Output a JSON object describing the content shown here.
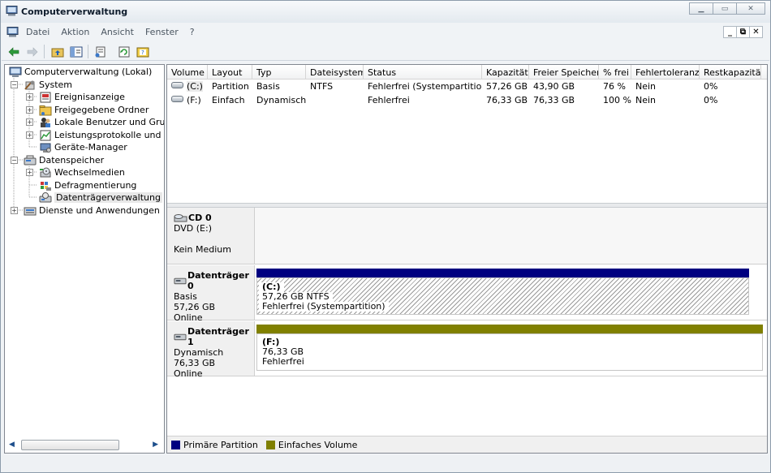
{
  "window": {
    "title": "Computerverwaltung"
  },
  "menu": {
    "items": [
      "Datei",
      "Aktion",
      "Ansicht",
      "Fenster",
      "?"
    ]
  },
  "tree": {
    "root": "Computerverwaltung (Lokal)",
    "system": "System",
    "ereignisanzeige": "Ereignisanzeige",
    "freigegebene": "Freigegebene Ordner",
    "benutzer": "Lokale Benutzer und Grupp",
    "leistung": "Leistungsprotokolle und W",
    "geraete": "Geräte-Manager",
    "datenspeicher": "Datenspeicher",
    "wechselmedien": "Wechselmedien",
    "defrag": "Defragmentierung",
    "datentraeger": "Datenträgerverwaltung",
    "dienste": "Dienste und Anwendungen"
  },
  "volumes": {
    "headers": [
      "Volume",
      "Layout",
      "Typ",
      "Dateisystem",
      "Status",
      "Kapazität",
      "Freier Speicher",
      "% frei",
      "Fehlertoleranz",
      "Restkapazität"
    ],
    "rows": [
      [
        "(C:)",
        "Partition",
        "Basis",
        "NTFS",
        "Fehlerfrei (Systempartition)",
        "57,26 GB",
        "43,90 GB",
        "76 %",
        "Nein",
        "0%"
      ],
      [
        "(F:)",
        "Einfach",
        "Dynamisch",
        "",
        "Fehlerfrei",
        "76,33 GB",
        "76,33 GB",
        "100 %",
        "Nein",
        "0%"
      ]
    ]
  },
  "disks": {
    "cd0": {
      "name": "CD 0",
      "type": "DVD (E:)",
      "media": "Kein Medium"
    },
    "disk0": {
      "name": "Datenträger 0",
      "type": "Basis",
      "size": "57,26 GB",
      "status": "Online",
      "partition": {
        "label": "(C:)",
        "size": "57,26 GB NTFS",
        "status": "Fehlerfrei (Systempartition)"
      }
    },
    "disk1": {
      "name": "Datenträger 1",
      "type": "Dynamisch",
      "size": "76,33 GB",
      "status": "Online",
      "partition": {
        "label": "(F:)",
        "size": "76,33 GB",
        "status": "Fehlerfrei"
      }
    }
  },
  "legend": {
    "primary": "Primäre Partition",
    "simple": "Einfaches Volume"
  },
  "colors": {
    "primary": "#000080",
    "simple": "#808000"
  }
}
